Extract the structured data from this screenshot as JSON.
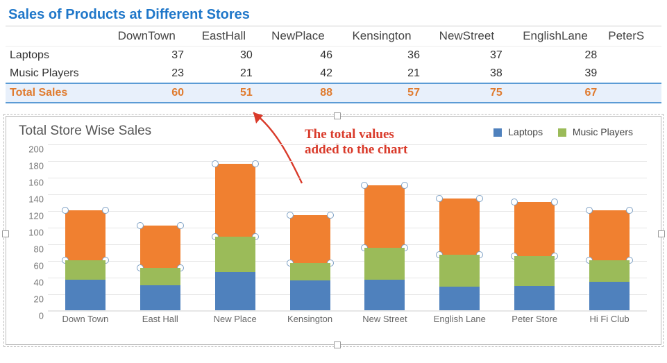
{
  "title": "Sales of Products at Different Stores",
  "table": {
    "headers": [
      "",
      "DownTown",
      "EastHall",
      "NewPlace",
      "Kensington",
      "NewStreet",
      "EnglishLane",
      "PeterS"
    ],
    "row1_label": "Laptops",
    "row1": [
      "37",
      "30",
      "46",
      "36",
      "37",
      "28",
      ""
    ],
    "row2_label": "Music Players",
    "row2": [
      "23",
      "21",
      "42",
      "21",
      "38",
      "39",
      ""
    ],
    "totals_label": "Total Sales",
    "totals": [
      "60",
      "51",
      "88",
      "57",
      "75",
      "67",
      ""
    ]
  },
  "annotation": {
    "line1": "The total values",
    "line2": "added to the chart"
  },
  "chart_title": "Total Store Wise Sales",
  "legend": {
    "a": "Laptops",
    "b": "Music Players"
  },
  "colors": {
    "laptop": "#4f81bd",
    "music": "#9bbb59",
    "total": "#f08030",
    "accent": "#1f77c9"
  },
  "yticks": [
    "0",
    "20",
    "40",
    "60",
    "80",
    "100",
    "120",
    "140",
    "160",
    "180",
    "200"
  ],
  "chart_data": {
    "type": "bar",
    "title": "Total Store Wise Sales",
    "xlabel": "",
    "ylabel": "",
    "ylim": [
      0,
      200
    ],
    "categories": [
      "Down Town",
      "East Hall",
      "New Place",
      "Kensington",
      "New Street",
      "English Lane",
      "Peter Store",
      "Hi Fi Club"
    ],
    "series": [
      {
        "name": "Laptops",
        "values": [
          37,
          30,
          46,
          36,
          37,
          28,
          29,
          34
        ]
      },
      {
        "name": "Music Players",
        "values": [
          23,
          21,
          42,
          21,
          38,
          39,
          36,
          26
        ]
      },
      {
        "name": "Total Sales",
        "values": [
          60,
          51,
          88,
          57,
          75,
          67,
          65,
          60
        ]
      }
    ],
    "legend_position": "top-right",
    "grid": true
  }
}
